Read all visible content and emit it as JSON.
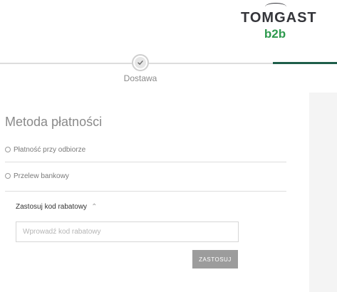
{
  "brand": {
    "name_top": "TOMGAST",
    "name_bottom": "b2b",
    "accent_color": "#2e9a4e",
    "dark_color": "#34353a"
  },
  "progress": {
    "active_color": "#1e5e4a",
    "steps": [
      {
        "label": "Dostawa",
        "state": "completed",
        "icon": "check-icon"
      }
    ]
  },
  "payment": {
    "title": "Metoda płatności",
    "options": [
      {
        "label": "Płatność przy odbiorze",
        "selected": false
      },
      {
        "label": "Przelew bankowy",
        "selected": false
      }
    ]
  },
  "coupon": {
    "toggle_label": "Zastosuj kod rabatowy",
    "toggle_icon": "chevron-up-icon",
    "input_placeholder": "Wprowadź kod rabatowy",
    "input_value": "",
    "apply_label": "ZASTOSUJ"
  }
}
